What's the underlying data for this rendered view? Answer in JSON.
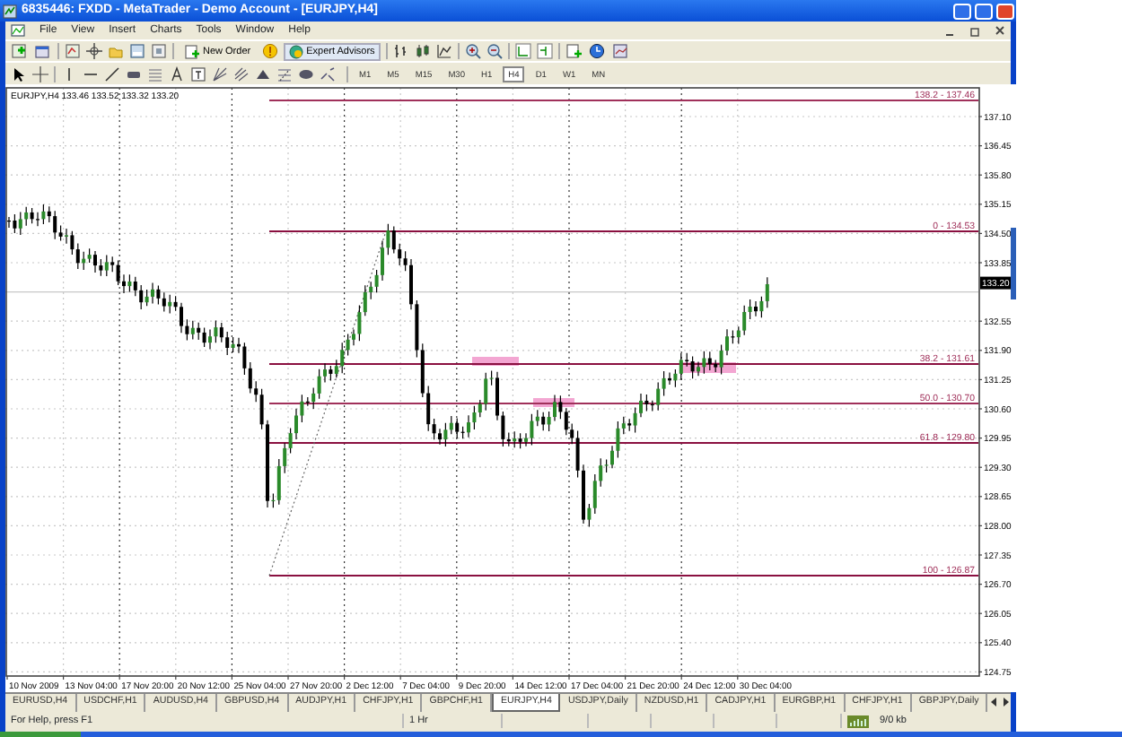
{
  "window": {
    "title": "6835446: FXDD - MetaTrader - Demo Account - [EURJPY,H4]"
  },
  "menu": [
    "File",
    "View",
    "Insert",
    "Charts",
    "Tools",
    "Window",
    "Help"
  ],
  "toolbar": {
    "buttons": [
      "New Order",
      "Expert Advisors"
    ],
    "timeframes": [
      {
        "label": "M1",
        "selected": false
      },
      {
        "label": "M5",
        "selected": false
      },
      {
        "label": "M15",
        "selected": false
      },
      {
        "label": "M30",
        "selected": false
      },
      {
        "label": "H1",
        "selected": false
      },
      {
        "label": "H4",
        "selected": true
      },
      {
        "label": "D1",
        "selected": false
      },
      {
        "label": "W1",
        "selected": false
      },
      {
        "label": "MN",
        "selected": false
      }
    ]
  },
  "chart": {
    "header": "EURJPY,H4 133.46 133.52 133.32 133.20",
    "price_axis": [
      "137.10",
      "136.45",
      "135.80",
      "135.15",
      "134.50",
      "133.85",
      "132.55",
      "131.90",
      "131.25",
      "130.60",
      "129.95",
      "129.30",
      "128.65",
      "128.00",
      "127.35",
      "126.70",
      "126.05",
      "125.40",
      "124.75"
    ],
    "current_price": "133.20",
    "fibonacci_levels": [
      {
        "label": "138.2 - 137.46"
      },
      {
        "label": "0 - 134.53"
      },
      {
        "label": "38.2 - 131.61"
      },
      {
        "label": "50.0 - 130.70"
      },
      {
        "label": "61.8 - 129.80"
      },
      {
        "label": "100 - 126.87"
      }
    ],
    "date_axis": [
      "10 Nov 2009",
      "13 Nov 04:00",
      "17 Nov 20:00",
      "20 Nov 12:00",
      "25 Nov 04:00",
      "27 Nov 20:00",
      "2 Dec 12:00",
      "7 Dec 04:00",
      "9 Dec 20:00",
      "14 Dec 12:00",
      "17 Dec 04:00",
      "21 Dec 20:00",
      "24 Dec 12:00",
      "30 Dec 04:00"
    ]
  },
  "tabs": [
    {
      "label": "EURUSD,H4",
      "selected": false
    },
    {
      "label": "USDCHF,H1",
      "selected": false
    },
    {
      "label": "AUDUSD,H4",
      "selected": false
    },
    {
      "label": "GBPUSD,H4",
      "selected": false
    },
    {
      "label": "AUDJPY,H1",
      "selected": false
    },
    {
      "label": "CHFJPY,H1",
      "selected": false
    },
    {
      "label": "GBPCHF,H1",
      "selected": false
    },
    {
      "label": "EURJPY,H4",
      "selected": true
    },
    {
      "label": "USDJPY,Daily",
      "selected": false
    },
    {
      "label": "NZDUSD,H1",
      "selected": false
    },
    {
      "label": "CADJPY,H1",
      "selected": false
    },
    {
      "label": "EURGBP,H1",
      "selected": false
    },
    {
      "label": "CHFJPY,H1",
      "selected": false
    },
    {
      "label": "GBPJPY,Daily",
      "selected": false
    }
  ],
  "status_bar": [
    "For Help, press F1",
    "1 Hr",
    "9/0 kb"
  ]
}
